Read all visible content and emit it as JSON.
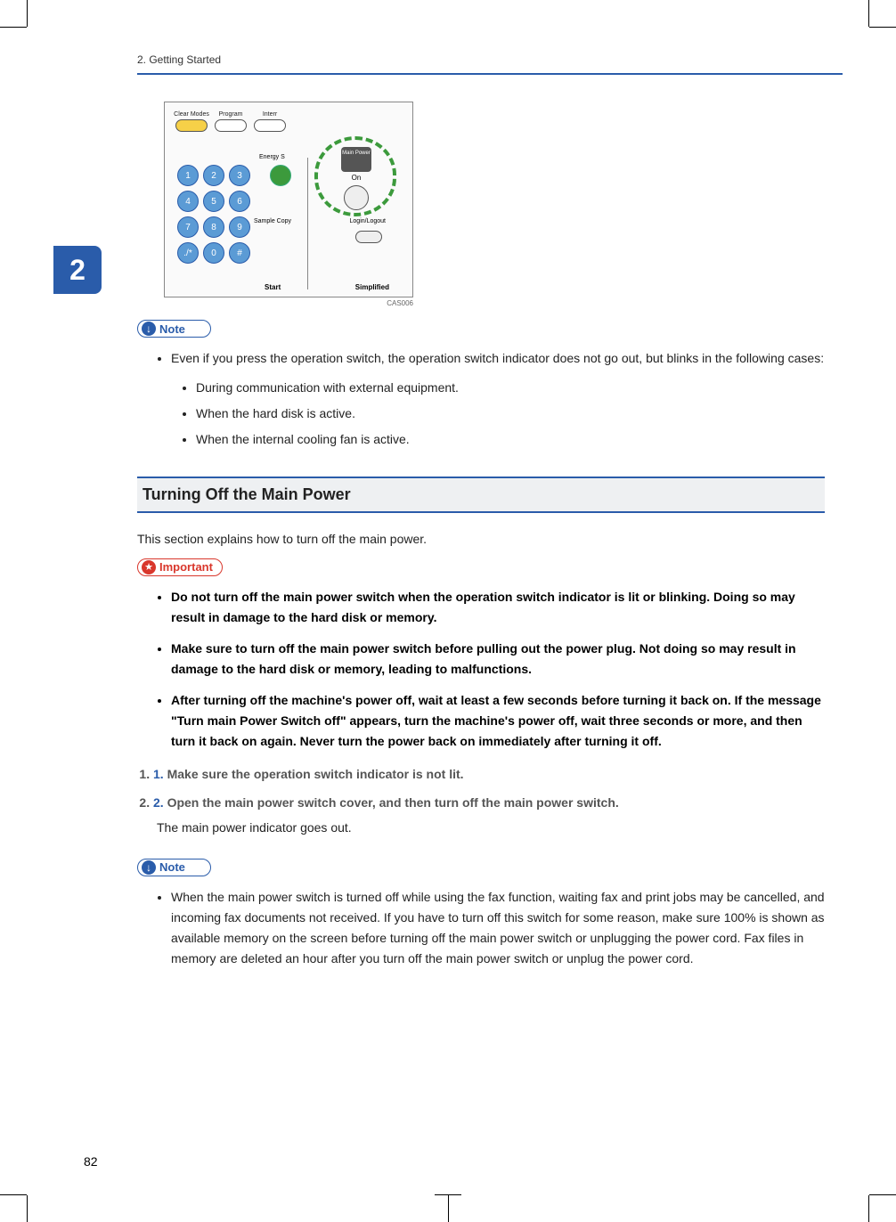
{
  "header": {
    "chapter_label": "2. Getting Started"
  },
  "chapter_tab": "2",
  "figure": {
    "labels": {
      "clear_modes": "Clear Modes",
      "program": "Program",
      "interr": "Interr",
      "energy": "Energy S",
      "sample_copy": "Sample Copy",
      "login_logout": "Login/Logout",
      "start": "Start",
      "simplified": "Simplified",
      "main_power": "Main Power",
      "on": "On"
    },
    "keys": [
      "1",
      "2",
      "3",
      "4",
      "5",
      "6",
      "7",
      "8",
      "9",
      "./*",
      "0",
      "#"
    ],
    "caption": "CAS006"
  },
  "note1": {
    "label": "Note",
    "items": [
      "Even if you press the operation switch, the operation switch indicator does not go out, but blinks in the following cases:"
    ],
    "sub_items": [
      "During communication with external equipment.",
      "When the hard disk is active.",
      "When the internal cooling fan is active."
    ]
  },
  "section": {
    "title": "Turning Off the Main Power",
    "intro": "This section explains how to turn off the main power."
  },
  "important": {
    "label": "Important",
    "items": [
      "Do not turn off the main power switch when the operation switch indicator is lit or blinking. Doing so may result in damage to the hard disk or memory.",
      "Make sure to turn off the main power switch before pulling out the power plug. Not doing so may result in damage to the hard disk or memory, leading to malfunctions.",
      "After turning off the machine's power off, wait at least a few seconds before turning it back on. If the message \"Turn main Power Switch off\" appears, turn the machine's power off, wait three seconds or more, and then turn it back on again. Never turn the power back on immediately after turning it off."
    ]
  },
  "steps": [
    {
      "num": "1.",
      "text": "Make sure the operation switch indicator is not lit."
    },
    {
      "num": "2.",
      "text": "Open the main power switch cover, and then turn off the main power switch.",
      "sub": "The main power indicator goes out."
    }
  ],
  "note2": {
    "label": "Note",
    "items": [
      "When the main power switch is turned off while using the fax function, waiting fax and print jobs may be cancelled, and incoming fax documents not received. If you have to turn off this switch for some reason, make sure 100% is shown as available memory on the screen before turning off the main power switch or unplugging the power cord. Fax files in memory are deleted an hour after you turn off the main power switch or unplug the power cord."
    ]
  },
  "page_number": "82"
}
